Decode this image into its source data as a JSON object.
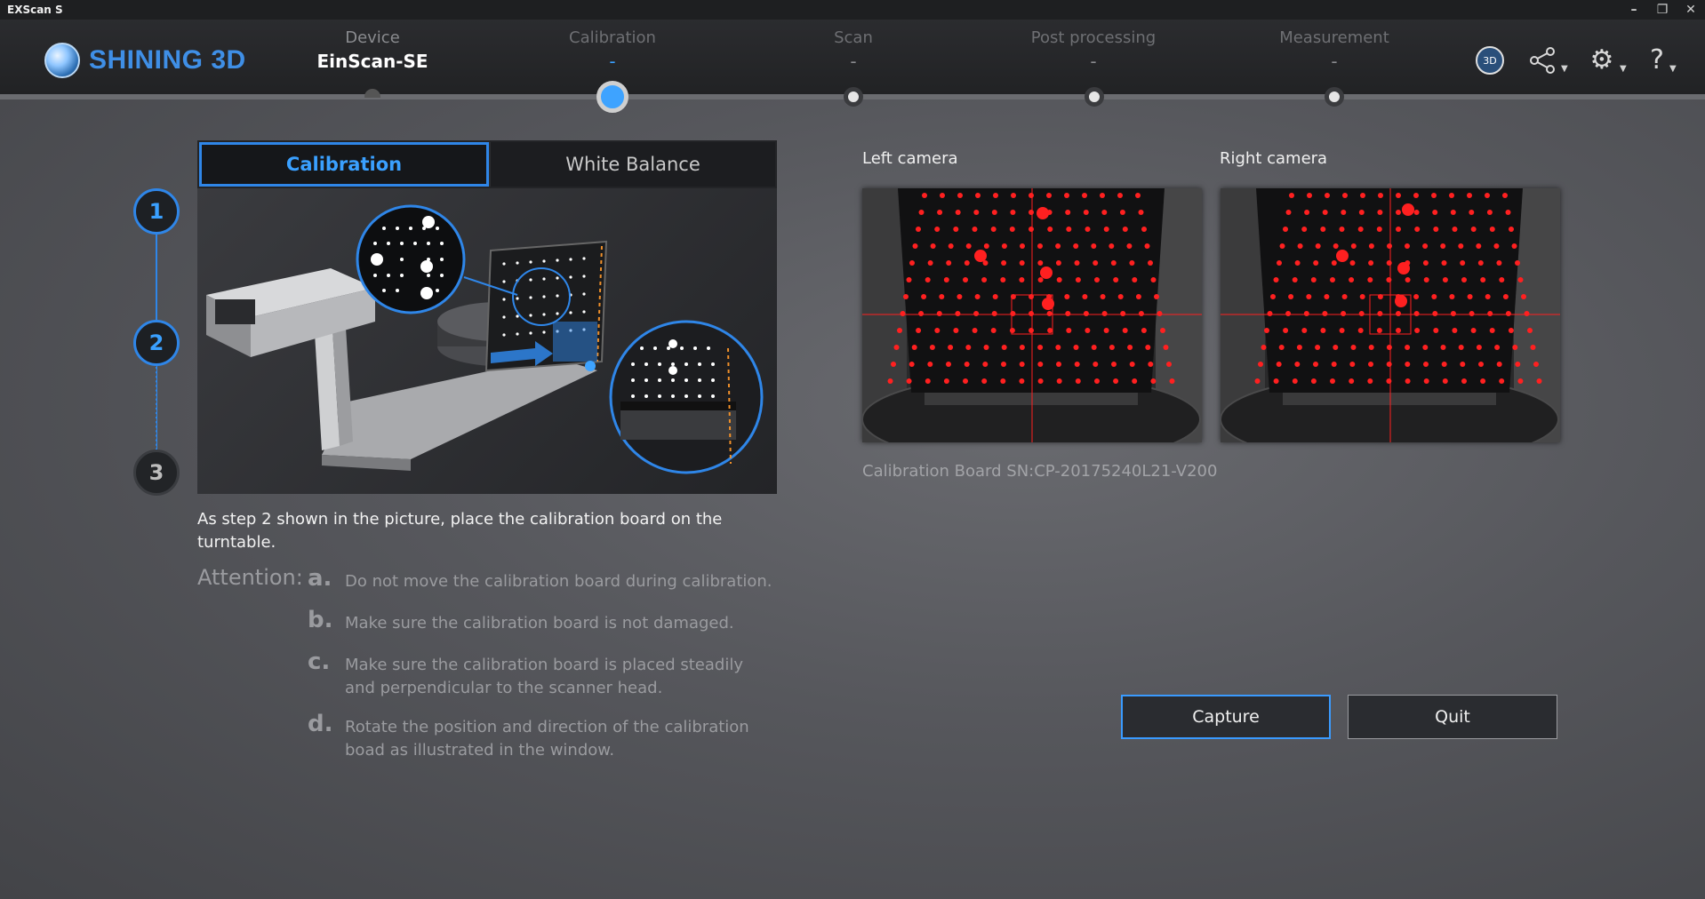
{
  "window": {
    "title": "EXScan S"
  },
  "brand": {
    "name": "SHINING 3D"
  },
  "steps": [
    {
      "label": "Device",
      "value": "EinScan-SE"
    },
    {
      "label": "Calibration",
      "value": "-"
    },
    {
      "label": "Scan",
      "value": "-"
    },
    {
      "label": "Post processing",
      "value": "-"
    },
    {
      "label": "Measurement",
      "value": "-"
    }
  ],
  "header_icons": [
    "3d-model-icon",
    "share-icon",
    "gear-icon",
    "help-icon"
  ],
  "sidebar": {
    "numbers": [
      "1",
      "2",
      "3"
    ]
  },
  "tabs": {
    "calibration": "Calibration",
    "white_balance": "White Balance"
  },
  "instruction": "As step 2 shown in the picture, place the calibration board on the turntable.",
  "attention": {
    "title": "Attention:",
    "items": [
      {
        "letter": "a.",
        "text": "Do not move the calibration board during calibration."
      },
      {
        "letter": "b.",
        "text": "Make sure the calibration board is not damaged."
      },
      {
        "letter": "c.",
        "text": "Make sure the calibration board is placed steadily and perpendicular to the scanner head."
      },
      {
        "letter": "d.",
        "text": "Rotate the position and direction of the calibration boad as illustrated in the window."
      }
    ]
  },
  "cameras": {
    "left_label": "Left camera",
    "right_label": "Right camera"
  },
  "calibration_board": {
    "sn": "Calibration Board SN:CP-20175240L21-V200"
  },
  "buttons": {
    "capture": "Capture",
    "quit": "Quit"
  },
  "colors": {
    "accent": "#2f86e8",
    "marker": "#ff2020"
  }
}
